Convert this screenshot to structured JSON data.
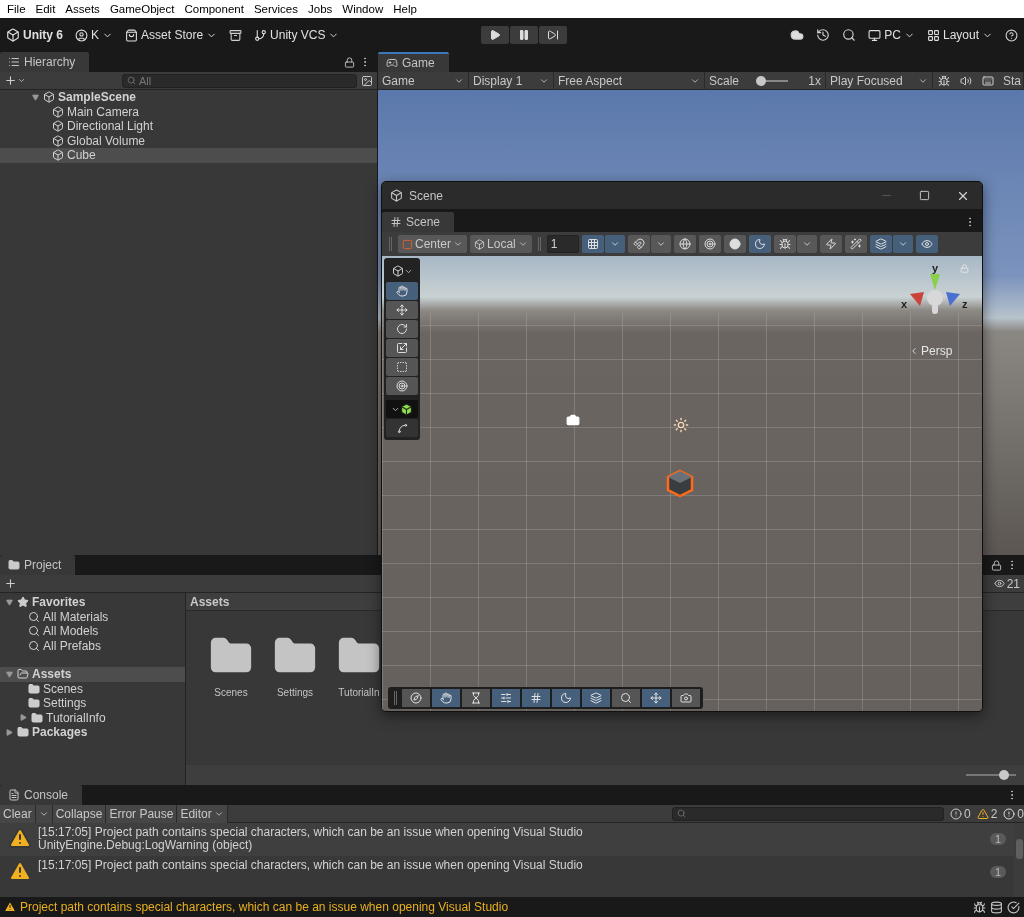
{
  "menu": [
    "File",
    "Edit",
    "Assets",
    "GameObject",
    "Component",
    "Services",
    "Jobs",
    "Window",
    "Help"
  ],
  "toolbar": {
    "product": "Unity 6",
    "account": "K",
    "store": "Asset Store",
    "vcs": "Unity VCS",
    "platform": "PC",
    "layout": "Layout"
  },
  "hierarchy": {
    "title": "Hierarchy",
    "search_placeholder": "All",
    "tree": [
      {
        "name": "SampleScene",
        "expanded": true,
        "selected": false,
        "children": [
          {
            "name": "Main Camera",
            "selected": false
          },
          {
            "name": "Directional Light",
            "selected": false
          },
          {
            "name": "Global Volume",
            "selected": false
          },
          {
            "name": "Cube",
            "selected": true
          }
        ]
      }
    ]
  },
  "game": {
    "tab": "Game",
    "view": "Game",
    "display": "Display 1",
    "aspect": "Free Aspect",
    "scale_label": "Scale",
    "scale": {
      "level": 0.05
    },
    "scale_value": "1x",
    "play_mode": "Play Focused",
    "cut_label": "Sta"
  },
  "scene": {
    "window_title": "Scene",
    "tab": "Scene",
    "pivot": "Center",
    "space": "Local",
    "grid_size": "1",
    "toggles": [
      {
        "kind": "split",
        "selected": true
      },
      {
        "kind": "split",
        "selected": false
      },
      {
        "kind": "button",
        "selected": false
      },
      {
        "kind": "button",
        "selected": false
      },
      {
        "kind": "button",
        "selected": false
      },
      {
        "kind": "button",
        "selected": true
      },
      {
        "kind": "split",
        "selected": false
      },
      {
        "kind": "button",
        "selected": false
      },
      {
        "kind": "button",
        "selected": false
      },
      {
        "kind": "split",
        "selected": true
      },
      {
        "kind": "button",
        "selected": true
      }
    ],
    "tools": [
      {
        "selected": true
      },
      {
        "selected": false
      },
      {
        "selected": false
      },
      {
        "selected": false
      },
      {
        "selected": false
      },
      {
        "selected": false
      }
    ],
    "overlay": [
      {
        "selected": false
      },
      {
        "selected": true
      },
      {
        "selected": false
      },
      {
        "selected": true
      },
      {
        "selected": true
      },
      {
        "selected": true
      },
      {
        "selected": true
      },
      {
        "selected": false
      },
      {
        "selected": true
      },
      {
        "selected": false
      }
    ],
    "axes": [
      "y",
      "x",
      "z"
    ],
    "projection": "Persp"
  },
  "project": {
    "tab": "Project",
    "hidden_count": "21",
    "breadcrumb": "Assets",
    "tree": [
      {
        "label": "Favorites",
        "kind": "favorites",
        "expanded": true,
        "selected": false,
        "children": [
          {
            "label": "All Materials",
            "kind": "search",
            "selected": false
          },
          {
            "label": "All Models",
            "kind": "search",
            "selected": false
          },
          {
            "label": "All Prefabs",
            "kind": "search",
            "selected": false
          }
        ]
      },
      {
        "label": "Assets",
        "kind": "folder",
        "expanded": true,
        "selected": true,
        "children": [
          {
            "label": "Scenes",
            "kind": "folder",
            "selected": false
          },
          {
            "label": "Settings",
            "kind": "folder",
            "selected": false
          },
          {
            "label": "TutorialInfo",
            "kind": "folder",
            "expanded": false,
            "selected": false
          }
        ]
      },
      {
        "label": "Packages",
        "kind": "folder",
        "expanded": false,
        "selected": false
      }
    ],
    "items": [
      "Scenes",
      "Settings",
      "TutorialIn"
    ],
    "icon_size": {
      "level": 0.75
    }
  },
  "console": {
    "tab": "Console",
    "buttons": [
      {
        "label": "Clear",
        "kind": "split"
      },
      {
        "label": "Collapse",
        "kind": "toggle",
        "selected": false
      },
      {
        "label": "Error Pause",
        "kind": "toggle",
        "selected": false
      },
      {
        "label": "Editor",
        "kind": "dropdown"
      }
    ],
    "counts": [
      {
        "kind": "info",
        "value": "0"
      },
      {
        "kind": "warning",
        "value": "2"
      },
      {
        "kind": "error",
        "value": "0"
      }
    ],
    "entries": [
      {
        "lines": [
          "[15:17:05] Project path contains special characters, which can be an issue when opening Visual Studio",
          "UnityEngine.Debug:LogWarning (object)"
        ],
        "count": "1"
      },
      {
        "lines": [
          "[15:17:05] Project path contains special characters, which can be an issue when opening Visual Studio"
        ],
        "count": "1"
      }
    ]
  },
  "status": "Project path contains special characters, which can be an issue when opening Visual Studio"
}
